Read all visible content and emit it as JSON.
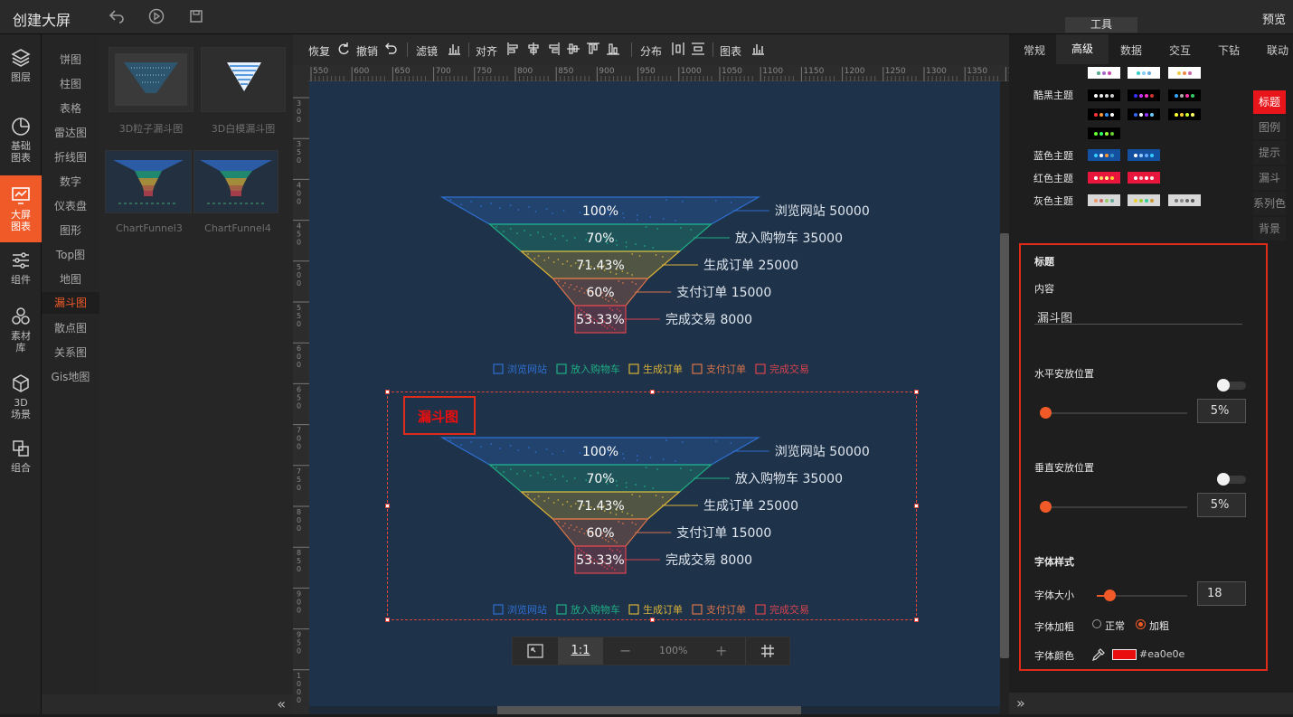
{
  "header": {
    "title": "创建大屏",
    "preview_label": "预览"
  },
  "left_icons": [
    {
      "label": "图层",
      "icon": "layers-icon"
    },
    {
      "label": "基础图表",
      "icon": "pie-clock-icon"
    },
    {
      "label": "大屏图表",
      "icon": "monitor-chart-icon"
    },
    {
      "label": "组件",
      "icon": "sliders-icon"
    },
    {
      "label": "素材库",
      "icon": "hexagons-icon"
    },
    {
      "label": "3D场景",
      "icon": "cube-icon"
    },
    {
      "label": "组合",
      "icon": "group-icon"
    }
  ],
  "left_menu": [
    "饼图",
    "柱图",
    "表格",
    "雷达图",
    "折线图",
    "数字",
    "仪表盘",
    "图形",
    "Top图",
    "地图",
    "漏斗图",
    "散点图",
    "关系图",
    "Gis地图"
  ],
  "left_menu_active": "漏斗图",
  "thumbs": [
    "3D粒子漏斗图",
    "3D白模漏斗图",
    "ChartFunnel3",
    "ChartFunnel4"
  ],
  "toolbar": {
    "redo": "恢复",
    "undo": "撤销",
    "filter": "滤镜",
    "align": "对齐",
    "distribute": "分布",
    "chart": "图表"
  },
  "ruler_ticks": [
    "550",
    "600",
    "650",
    "700",
    "750",
    "800",
    "850",
    "900",
    "950",
    "1000",
    "1050",
    "1100",
    "1150",
    "1200",
    "1250",
    "1300",
    "1350",
    "14"
  ],
  "vruler_ticks": [
    "300",
    "350",
    "400",
    "450",
    "500",
    "550",
    "600",
    "650",
    "700",
    "750",
    "800",
    "850",
    "900",
    "950",
    "1000"
  ],
  "chart_data": [
    {
      "type": "funnel",
      "categories": [
        "浏览网站",
        "放入购物车",
        "生成订单",
        "支付订单",
        "完成交易"
      ],
      "values": [
        50000,
        35000,
        25000,
        15000,
        8000
      ],
      "percent_labels": [
        "100%",
        "70%",
        "71.43%",
        "60%",
        "53.33%"
      ],
      "legend": [
        "浏览网站",
        "放入购物车",
        "生成订单",
        "支付订单",
        "完成交易"
      ],
      "colors": [
        "#2f6fd1",
        "#1fae84",
        "#d9b23a",
        "#d9744a",
        "#d8434f"
      ],
      "title": ""
    },
    {
      "type": "funnel",
      "categories": [
        "浏览网站",
        "放入购物车",
        "生成订单",
        "支付订单",
        "完成交易"
      ],
      "values": [
        50000,
        35000,
        25000,
        15000,
        8000
      ],
      "percent_labels": [
        "100%",
        "70%",
        "71.43%",
        "60%",
        "53.33%"
      ],
      "legend": [
        "浏览网站",
        "放入购物车",
        "生成订单",
        "支付订单",
        "完成交易"
      ],
      "colors": [
        "#2f6fd1",
        "#1fae84",
        "#d9b23a",
        "#d9744a",
        "#d8434f"
      ],
      "title": "漏斗图",
      "title_color": "#ea0e0e"
    }
  ],
  "zoom": {
    "value": "100%",
    "ratio_label": "1:1"
  },
  "right": {
    "tool_badge": "工具",
    "tabs": [
      "常规",
      "高级",
      "数据",
      "交互",
      "下钻",
      "联动"
    ],
    "active_tab": "高级",
    "themes": [
      {
        "label": "酷黑主题"
      },
      {
        "label": "蓝色主题"
      },
      {
        "label": "红色主题"
      },
      {
        "label": "灰色主题"
      }
    ],
    "side_tabs": [
      "标题",
      "图例",
      "提示",
      "漏斗",
      "系列色",
      "背景"
    ],
    "active_side_tab": "标题",
    "panel": {
      "section_title": "标题",
      "content_label": "内容",
      "content_value": "漏斗图",
      "h_pos_label": "水平安放位置",
      "h_pos_value": "5%",
      "v_pos_label": "垂直安放位置",
      "v_pos_value": "5%",
      "font_style_label": "字体样式",
      "font_size_label": "字体大小",
      "font_size_value": "18",
      "font_weight_label": "字体加粗",
      "font_weight_normal": "正常",
      "font_weight_bold": "加粗",
      "font_color_label": "字体颜色",
      "font_color_value": "#ea0e0e"
    }
  }
}
